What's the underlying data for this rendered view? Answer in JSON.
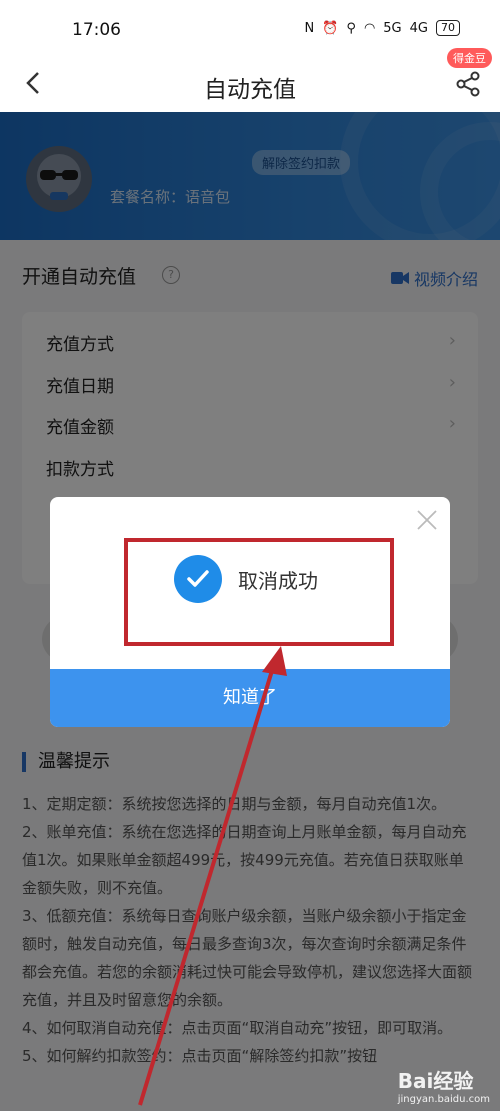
{
  "status_bar": {
    "time": "17:06",
    "network": "5G",
    "network2": "4G",
    "battery": "70"
  },
  "nav": {
    "title": "自动充值",
    "badge": "得金豆"
  },
  "header": {
    "unsign_label": "解除签约扣款",
    "package_name": "套餐名称：语音包"
  },
  "section": {
    "title": "开通自动充值",
    "video_label": "视频介绍"
  },
  "settings": {
    "items": [
      {
        "label": "充值方式"
      },
      {
        "label": "充值日期"
      },
      {
        "label": "充值金额"
      },
      {
        "label": "扣款方式"
      }
    ]
  },
  "dialog": {
    "message": "取消成功",
    "ok_label": "知道了"
  },
  "tips": {
    "title": "温馨提示",
    "lines": [
      "1、定期定额：系统按您选择的日期与金额，每月自动充值1次。",
      "2、账单充值：系统在您选择的日期查询上月账单金额，每月自动充值1次。如果账单金额超499元，按499元充值。若充值日获取账单金额失败，则不充值。",
      "3、低额充值：系统每日查询账户级余额，当账户级余额小于指定金额时，触发自动充值，每日最多查询3次，每次查询时余额满足条件都会充值。若您的余额消耗过快可能会导致停机，建议您选择大面额充值，并且及时留意您的余额。",
      "4、如何取消自动充值：点击页面“取消自动充”按钮，即可取消。",
      "5、如何解约扣款签约：点击页面“解除签约扣款”按钮"
    ]
  },
  "watermark": {
    "brand": "Bai经验",
    "url": "jingyan.baidu.com"
  },
  "colors": {
    "primary": "#3d93ee",
    "annotation": "#c0282e"
  }
}
